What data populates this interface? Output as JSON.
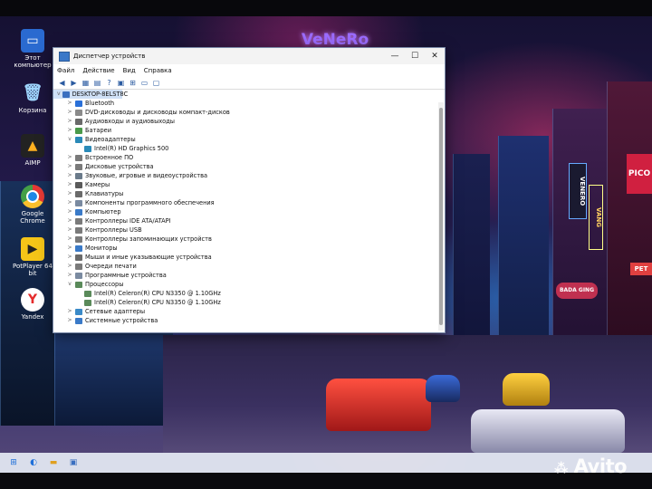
{
  "desktop": {
    "icons": [
      {
        "label": "Этот\nкомпьютер",
        "icon": "monitor-icon"
      },
      {
        "label": "Корзина",
        "icon": "recycle-bin-icon"
      },
      {
        "label": "AIMP",
        "icon": "aimp-icon"
      },
      {
        "label": "Google\nChrome",
        "icon": "chrome-icon"
      },
      {
        "label": "PotPlayer 64\nbit",
        "icon": "potplayer-icon"
      },
      {
        "label": "Yandex",
        "icon": "yandex-icon"
      }
    ],
    "wallpaper_signs": [
      "VeNeRo",
      "VENERO",
      "PICO",
      "BADA GING",
      "PET",
      "VANG"
    ]
  },
  "window": {
    "title": "Диспетчер устройств",
    "menu": [
      "Файл",
      "Действие",
      "Вид",
      "Справка"
    ],
    "controls": {
      "minimize": "—",
      "maximize": "☐",
      "close": "✕"
    },
    "tree": [
      {
        "label": "DESKTOP-8ELST8C",
        "level": 0,
        "expander": "v",
        "icon": "#3a6fc0",
        "root": true
      },
      {
        "label": "Bluetooth",
        "level": 1,
        "expander": ">",
        "icon": "#2a70d8"
      },
      {
        "label": "DVD-дисководы и дисководы компакт-дисков",
        "level": 1,
        "expander": ">",
        "icon": "#8a8a8a"
      },
      {
        "label": "Аудиовходы и аудиовыходы",
        "level": 1,
        "expander": ">",
        "icon": "#6a6a6a"
      },
      {
        "label": "Батареи",
        "level": 1,
        "expander": ">",
        "icon": "#4a9a4a"
      },
      {
        "label": "Видеоадаптеры",
        "level": 1,
        "expander": "v",
        "icon": "#2a8ab8"
      },
      {
        "label": "Intel(R) HD Graphics 500",
        "level": 2,
        "expander": "",
        "icon": "#2a8ab8"
      },
      {
        "label": "Встроенное ПО",
        "level": 1,
        "expander": ">",
        "icon": "#7a7a7a"
      },
      {
        "label": "Дисковые устройства",
        "level": 1,
        "expander": ">",
        "icon": "#7a7a7a"
      },
      {
        "label": "Звуковые, игровые и видеоустройства",
        "level": 1,
        "expander": ">",
        "icon": "#6a7a8a"
      },
      {
        "label": "Камеры",
        "level": 1,
        "expander": ">",
        "icon": "#5a5a5a"
      },
      {
        "label": "Клавиатуры",
        "level": 1,
        "expander": ">",
        "icon": "#6a6a6a"
      },
      {
        "label": "Компоненты программного обеспечения",
        "level": 1,
        "expander": ">",
        "icon": "#7a8aa0"
      },
      {
        "label": "Компьютер",
        "level": 1,
        "expander": ">",
        "icon": "#3a7ac8"
      },
      {
        "label": "Контроллеры IDE ATA/ATAPI",
        "level": 1,
        "expander": ">",
        "icon": "#7a7a7a"
      },
      {
        "label": "Контроллеры USB",
        "level": 1,
        "expander": ">",
        "icon": "#7a7a7a"
      },
      {
        "label": "Контроллеры запоминающих устройств",
        "level": 1,
        "expander": ">",
        "icon": "#7a7a7a"
      },
      {
        "label": "Мониторы",
        "level": 1,
        "expander": ">",
        "icon": "#3a7ac8"
      },
      {
        "label": "Мыши и иные указывающие устройства",
        "level": 1,
        "expander": ">",
        "icon": "#6a6a6a"
      },
      {
        "label": "Очереди печати",
        "level": 1,
        "expander": ">",
        "icon": "#7a7a7a"
      },
      {
        "label": "Программные устройства",
        "level": 1,
        "expander": ">",
        "icon": "#7a8aa0"
      },
      {
        "label": "Процессоры",
        "level": 1,
        "expander": "v",
        "icon": "#5a8a5a"
      },
      {
        "label": "Intel(R) Celeron(R) CPU N3350 @ 1.10GHz",
        "level": 2,
        "expander": "",
        "icon": "#5a8a5a"
      },
      {
        "label": "Intel(R) Celeron(R) CPU N3350 @ 1.10GHz",
        "level": 2,
        "expander": "",
        "icon": "#5a8a5a"
      },
      {
        "label": "Сетевые адаптеры",
        "level": 1,
        "expander": ">",
        "icon": "#3a8ac8"
      },
      {
        "label": "Системные устройства",
        "level": 1,
        "expander": ">",
        "icon": "#3a7ac8"
      }
    ]
  },
  "taskbar": {
    "items": [
      "start-icon",
      "search-icon",
      "explorer-icon",
      "device-manager-icon"
    ]
  },
  "watermark": "Avito"
}
